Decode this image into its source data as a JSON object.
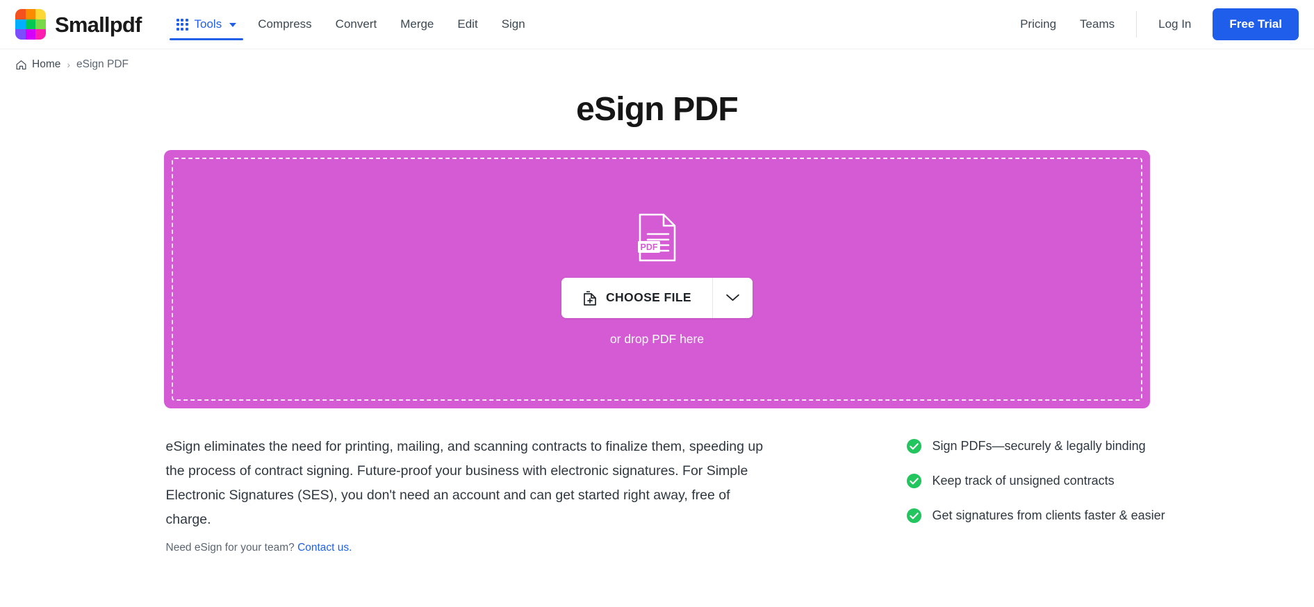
{
  "header": {
    "brand_name": "Smallpdf",
    "logo_colors": [
      "#f4511e",
      "#fb8c00",
      "#fdd835",
      "#00b0ff",
      "#00c853",
      "#76d945",
      "#7c4dff",
      "#d500f9",
      "#ff1eb0"
    ],
    "accent_blue": "#2160e6",
    "nav_left": [
      {
        "label": "Tools",
        "icon": "grid-dots-icon",
        "has_caret": true,
        "active": true
      },
      {
        "label": "Compress",
        "active": false
      },
      {
        "label": "Convert",
        "active": false
      },
      {
        "label": "Merge",
        "active": false
      },
      {
        "label": "Edit",
        "active": false
      },
      {
        "label": "Sign",
        "active": false
      }
    ],
    "nav_right": [
      {
        "label": "Pricing"
      },
      {
        "label": "Teams"
      }
    ],
    "login_label": "Log In",
    "free_trial_label": "Free Trial"
  },
  "breadcrumb": {
    "home_icon": "home-icon",
    "home_label": "Home",
    "separator": "›",
    "current_label": "eSign PDF"
  },
  "page_title": "eSign PDF",
  "dropzone": {
    "background_color": "#d45bd4",
    "file_icon": "pdf-document-icon",
    "file_icon_label": "PDF",
    "choose_file_label": "CHOOSE FILE",
    "choose_file_icon": "file-plus-icon",
    "dropdown_icon": "chevron-down-icon",
    "drop_hint": "or drop PDF here"
  },
  "description": {
    "body": "eSign eliminates the need for printing, mailing, and scanning contracts to finalize them, speeding up the process of contract signing. Future-proof your business with electronic signatures. For Simple Electronic Signatures (SES), you don't need an account and can get started right away, free of charge.",
    "team_prompt": "Need eSign for your team?",
    "team_link": "Contact us.",
    "link_color": "#2160e6"
  },
  "features": {
    "check_color": "#22c55e",
    "items": [
      {
        "label": "Sign PDFs—securely & legally binding"
      },
      {
        "label": "Keep track of unsigned contracts"
      },
      {
        "label": "Get signatures from clients faster & easier"
      }
    ]
  }
}
